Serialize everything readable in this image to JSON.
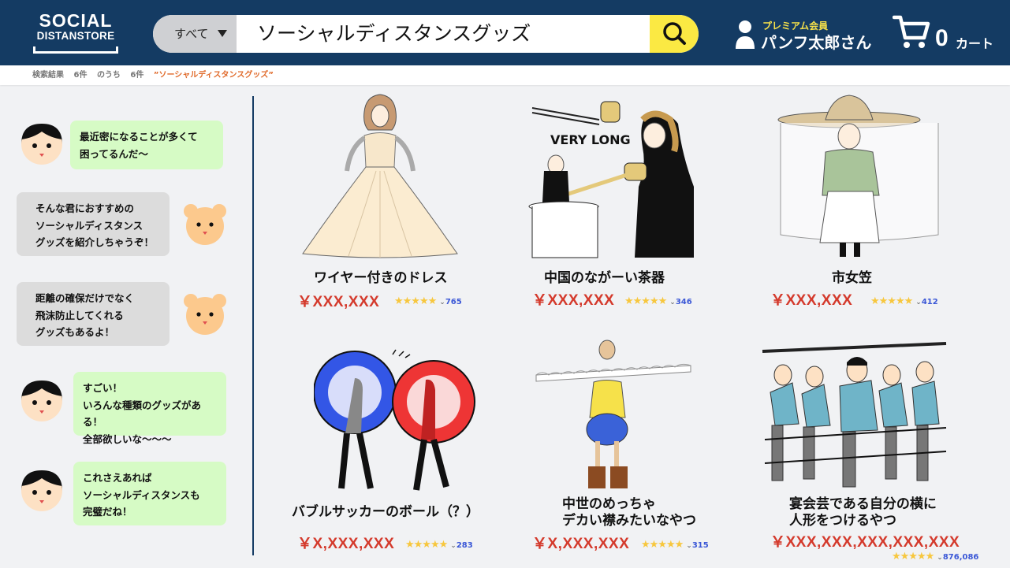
{
  "header": {
    "logo_line1": "SOCIAL",
    "logo_line2": "DISTANSTORE",
    "category_label": "すべて",
    "search_query": "ソーシャルディスタンスグッズ",
    "member_badge": "プレミアム会員",
    "user_name": "パンフ太郎さん",
    "cart_count": "0",
    "cart_label": "カート"
  },
  "breadcrumb": {
    "results_label": "検索結果",
    "count_a": "6件",
    "of_label": "のうち",
    "count_b": "6件",
    "query_quote": "”ソーシャルディスタンスグッズ”"
  },
  "chat": [
    {
      "speaker": "boy",
      "text1": "最近密になることが多くて",
      "text2": "困ってるんだ〜",
      "text3": ""
    },
    {
      "speaker": "bear",
      "text1": "そんな君におすすめの",
      "text2": "ソーシャルディスタンス",
      "text3": "グッズを紹介しちゃうぞ！"
    },
    {
      "speaker": "bear",
      "text1": "距離の確保だけでなく",
      "text2": "飛沫防止してくれる",
      "text3": "グッズもあるよ！"
    },
    {
      "speaker": "boy",
      "text1": "すごい！",
      "text2": "いろんな種類のグッズがある！",
      "text3": "全部欲しいな〜〜〜"
    },
    {
      "speaker": "boy",
      "text1": "これさえあれば",
      "text2": "ソーシャルディスタンスも",
      "text3": "完璧だね！"
    }
  ],
  "products": [
    {
      "name1": "ワイヤー付きのドレス",
      "name2": "",
      "price": "￥XXX,XXX",
      "stars": "★★★★★",
      "reviews": "765"
    },
    {
      "name1": "中国のながーい茶器",
      "name2": "",
      "price": "￥XXX,XXX",
      "stars": "★★★★★",
      "reviews": "346",
      "image_text": "VERY LONG"
    },
    {
      "name1": "市女笠",
      "name2": "",
      "price": "￥XXX,XXX",
      "stars": "★★★★★",
      "reviews": "412"
    },
    {
      "name1": "バブルサッカーのボール（？）",
      "name2": "",
      "price": "￥X,XXX,XXX",
      "stars": "★★★★★",
      "reviews": "283"
    },
    {
      "name1": "中世のめっちゃ",
      "name2": "デカい襟みたいなやつ",
      "price": "￥X,XXX,XXX",
      "stars": "★★★★★",
      "reviews": "315"
    },
    {
      "name1": "宴会芸である自分の横に",
      "name2": "人形をつけるやつ",
      "price": "￥XXX,XXX,XXX,XXX,XXX",
      "stars": "★★★★★",
      "reviews": "876,086"
    }
  ],
  "colors": {
    "header_bg": "#143b63",
    "search_button": "#fbe943",
    "price": "#d43a2c",
    "stars": "#f7c73e",
    "review_count": "#3a57d6",
    "bubble_green": "#d6fbc5",
    "bubble_gray": "#dcdcdc",
    "query_highlight": "#e06a2a"
  },
  "icons": [
    "search-icon",
    "user-icon",
    "cart-icon",
    "chevron-down-icon",
    "star-icon"
  ]
}
